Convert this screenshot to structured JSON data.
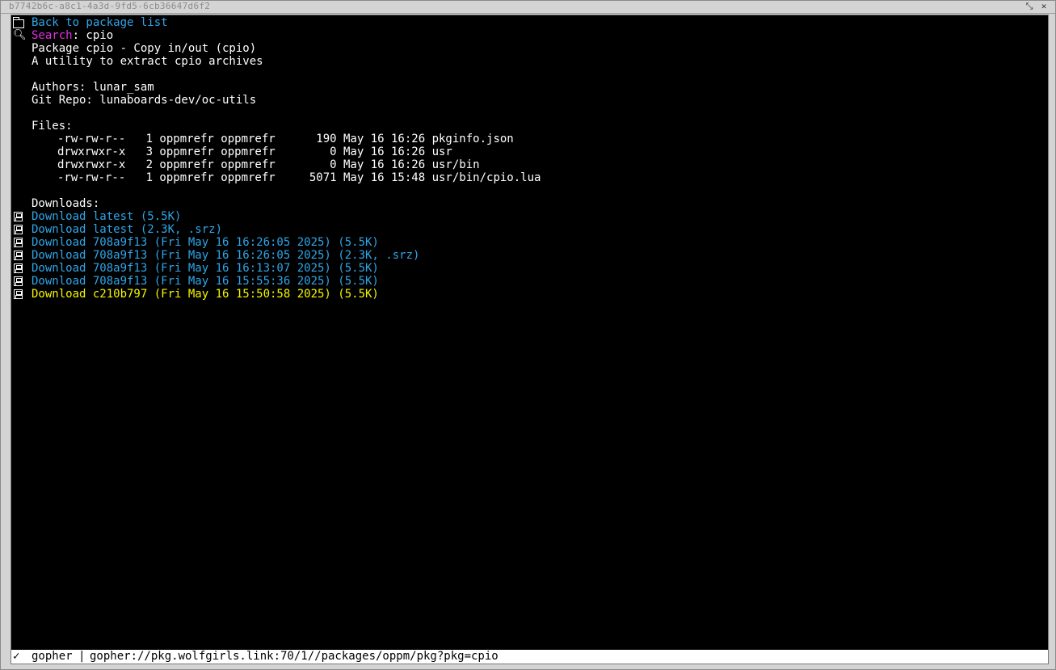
{
  "window": {
    "title": "b7742b6c-a8c1-4a3d-9fd5-6cb36647d6f2"
  },
  "page": {
    "back_link": "Back to package list",
    "search_label": "Search",
    "search_rest": ": cpio",
    "package_line": "Package cpio - Copy in/out (cpio)",
    "description": "A utility to extract cpio archives",
    "authors": "Authors: lunar_sam",
    "git_repo": "Git Repo: lunaboards-dev/oc-utils",
    "files_heading": "Files:",
    "files": [
      "-rw-rw-r--   1 oppmrefr oppmrefr      190 May 16 16:26 pkginfo.json",
      "drwxrwxr-x   3 oppmrefr oppmrefr        0 May 16 16:26 usr",
      "drwxrwxr-x   2 oppmrefr oppmrefr        0 May 16 16:26 usr/bin",
      "-rw-rw-r--   1 oppmrefr oppmrefr     5071 May 16 15:48 usr/bin/cpio.lua"
    ],
    "downloads_heading": "Downloads:",
    "downloads": [
      "Download latest (5.5K)",
      "Download latest (2.3K, .srz)",
      "Download 708a9f13 (Fri May 16 16:26:05 2025) (5.5K)",
      "Download 708a9f13 (Fri May 16 16:26:05 2025) (2.3K, .srz)",
      "Download 708a9f13 (Fri May 16 16:13:07 2025) (5.5K)",
      "Download 708a9f13 (Fri May 16 15:55:36 2025) (5.5K)",
      "Download c210b797 (Fri May 16 15:50:58 2025) (5.5K)"
    ]
  },
  "statusbar": {
    "check": "✓",
    "protocol": "gopher",
    "separator": "|",
    "url": "gopher://pkg.wolfgirls.link:70/1//packages/oppm/pkg?pkg=cpio"
  },
  "colors": {
    "link": "#2ea6e8",
    "selected_link": "#f5f500",
    "search_label": "#e030e0",
    "background": "#000000"
  }
}
